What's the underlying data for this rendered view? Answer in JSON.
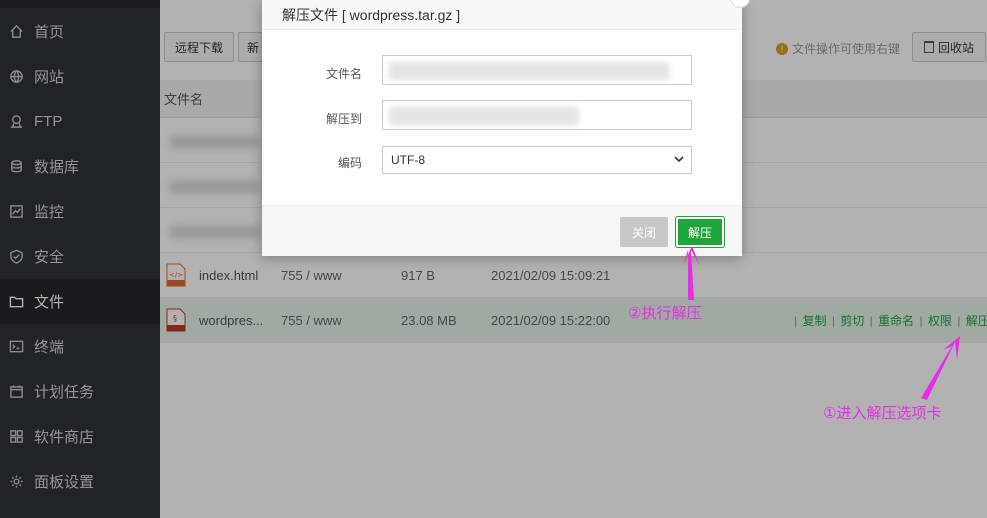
{
  "sidebar": {
    "items": [
      {
        "label": "首页",
        "icon": "home-icon"
      },
      {
        "label": "网站",
        "icon": "globe-icon"
      },
      {
        "label": "FTP",
        "icon": "ftp-icon"
      },
      {
        "label": "数据库",
        "icon": "database-icon"
      },
      {
        "label": "监控",
        "icon": "monitor-icon"
      },
      {
        "label": "安全",
        "icon": "shield-icon"
      },
      {
        "label": "文件",
        "icon": "folder-icon",
        "active": true
      },
      {
        "label": "终端",
        "icon": "terminal-icon"
      },
      {
        "label": "计划任务",
        "icon": "calendar-icon"
      },
      {
        "label": "软件商店",
        "icon": "apps-icon"
      },
      {
        "label": "面板设置",
        "icon": "gear-icon"
      }
    ]
  },
  "toolbar": {
    "remote_download_label": "远程下载",
    "new_label": "新",
    "tip_text": "文件操作可使用右键",
    "recycle_label": "回收站"
  },
  "table": {
    "header_name": "文件名",
    "rows": [
      {
        "name": "index.html",
        "perm": "755 / www",
        "size": "917 B",
        "time": "2021/02/09 15:09:21",
        "icon": "html-file-icon"
      },
      {
        "name": "wordpres...",
        "perm": "755 / www",
        "size": "23.08 MB",
        "time": "2021/02/09 15:22:00",
        "icon": "tar-file-icon",
        "selected": true
      }
    ],
    "ops": [
      "复制",
      "剪切",
      "重命名",
      "权限",
      "解压"
    ]
  },
  "modal": {
    "title": "解压文件 [ wordpress.tar.gz ]",
    "filename_label": "文件名",
    "extract_to_label": "解压到",
    "encoding_label": "编码",
    "encoding_value": "UTF-8",
    "close_label": "关闭",
    "extract_label": "解压"
  },
  "annotations": {
    "step1": "①进入解压选项卡",
    "step2": "②执行解压",
    "color": "#e62ee6"
  },
  "colors": {
    "sidebar_bg": "#2f3339",
    "accent_green": "#20a53a"
  }
}
